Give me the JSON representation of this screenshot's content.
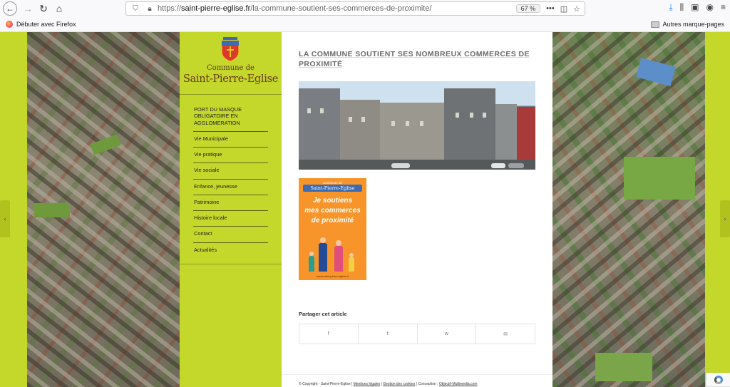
{
  "browser": {
    "url_proto": "https://",
    "url_host": "saint-pierre-eglise.fr",
    "url_path": "/la-commune-soutient-ses-commerces-de-proximite/",
    "zoom": "67 %",
    "bookmark_firefox": "Débuter avec Firefox",
    "bookmark_other": "Autres marque-pages"
  },
  "logo": {
    "line1": "Commune de",
    "line2": "Saint-Pierre-Eglise"
  },
  "menu": [
    "PORT DU MASQUE OBLIGATOIRE EN AGGLOMERATION",
    "Vie Municipale",
    "Vie pratique",
    "Vie sociale",
    "Enfance, jeunesse",
    "Patrimoine",
    "Histoire locale",
    "Contact",
    "Actualités"
  ],
  "article": {
    "title": "LA COMMUNE SOUTIENT SES NOMBREUX COMMERCES DE PROXIMITÉ"
  },
  "poster": {
    "commune": "Commune de",
    "name": "Saint-Pierre-Eglise",
    "line1": "Je soutiens",
    "line2": "mes commerces",
    "line3": "de proximité",
    "url": "www.saint-pierre-eglise.fr"
  },
  "share": {
    "title": "Partager cet article",
    "buttons": [
      "f",
      "t",
      "w",
      "✉"
    ]
  },
  "footer": {
    "copyright": "© Copyright - Saint-Pierre-Eglise |",
    "legal": "Mentions légales",
    "cookies": "Gestion des cookies",
    "conception": "| Conception :",
    "agency": "Objectif-Multimedia.com"
  },
  "colors": {
    "accent_green": "#c4d82c",
    "poster_orange": "#f7952a"
  }
}
